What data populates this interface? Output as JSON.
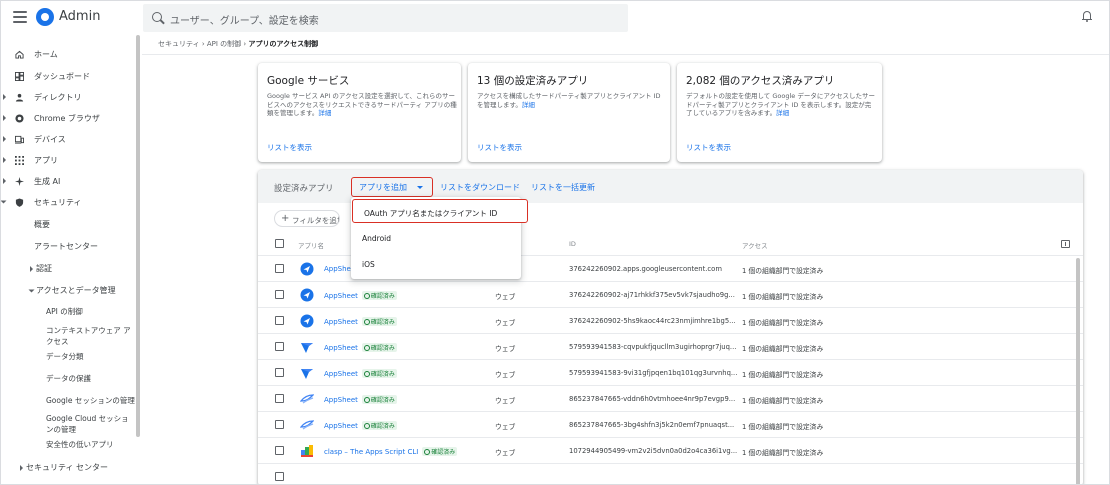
{
  "header": {
    "app_name": "Admin",
    "search_placeholder": "ユーザー、グループ、設定を検索"
  },
  "sidebar": {
    "items": [
      {
        "label": "ホーム",
        "icon": "home-icon"
      },
      {
        "label": "ダッシュボード",
        "icon": "dashboard-icon"
      },
      {
        "label": "ディレクトリ",
        "icon": "person-icon"
      },
      {
        "label": "Chrome ブラウザ",
        "icon": "chrome-icon"
      },
      {
        "label": "デバイス",
        "icon": "devices-icon"
      },
      {
        "label": "アプリ",
        "icon": "apps-grid-icon"
      },
      {
        "label": "生成 AI",
        "icon": "sparkle-icon"
      },
      {
        "label": "セキュリティ",
        "icon": "shield-icon"
      }
    ],
    "security_sub": [
      "概要",
      "アラートセンター",
      "認証",
      "アクセスとデータ管理"
    ],
    "access_sub": [
      "API の制御",
      "コンテキストアウェア アクセス",
      "データ分類",
      "データの保護",
      "Google セッションの管理",
      "Google Cloud セッションの管理",
      "安全性の低いアプリ"
    ],
    "security_center": "セキュリティ センター"
  },
  "breadcrumb": {
    "part1": "セキュリティ",
    "part2": "API の制御",
    "current": "アプリのアクセス制御",
    "sep": "›"
  },
  "cards": [
    {
      "title": "Google サービス",
      "desc": "Google サービス API のアクセス設定を選択して、これらのサービスへのアクセスをリクエストできるサードパーティ アプリの種類を管理します。",
      "more": "詳細",
      "link": "リストを表示"
    },
    {
      "title": "13 個の設定済みアプリ",
      "desc": "アクセスを構成したサードパーティ製アプリとクライアント ID を管理します。",
      "more": "詳細",
      "link": "リストを表示"
    },
    {
      "title": "2,082 個のアクセス済みアプリ",
      "desc": "デフォルトの設定を使用して Google データにアクセスしたサードパーティ製アプリとクライアント ID を表示します。設定が完了しているアプリを含みます。",
      "more": "詳細",
      "link": "リストを表示"
    }
  ],
  "panel": {
    "title": "設定済みアプリ",
    "add_app": "アプリを追加",
    "download": "リストをダウンロード",
    "bulk_update": "リストを一括更新",
    "filter": "フィルタを追加"
  },
  "dropdown": {
    "items": [
      "OAuth アプリ名またはクライアント ID",
      "Android",
      "iOS"
    ]
  },
  "table": {
    "headers": {
      "name": "アプリ名",
      "id": "ID",
      "access": "アクセス"
    },
    "verified_label": "確認済み",
    "rows": [
      {
        "name": "AppSheet",
        "type": "",
        "id": "376242260902.apps.googleusercontent.com",
        "access": "1 個の組織部門で設定済み",
        "icon": "appsheet-blue-icon",
        "verified": false
      },
      {
        "name": "AppSheet",
        "type": "ウェブ",
        "id": "376242260902-aj71rhkkf375ev5vk7sjaudho9g...",
        "access": "1 個の組織部門で設定済み",
        "icon": "appsheet-blue-icon",
        "verified": true
      },
      {
        "name": "AppSheet",
        "type": "ウェブ",
        "id": "376242260902-5hs9kaoc44rc23nmjimhre1bg5...",
        "access": "1 個の組織部門で設定済み",
        "icon": "appsheet-blue-icon",
        "verified": true
      },
      {
        "name": "AppSheet",
        "type": "ウェブ",
        "id": "579593941583-cqvpukfjqucllm3ugirhoprgr7juq...",
        "access": "1 個の組織部門で設定済み",
        "icon": "appsheet-check-icon",
        "verified": true
      },
      {
        "name": "AppSheet",
        "type": "ウェブ",
        "id": "579593941583-9vi31gfjpqen1bq101qg3urvnhq...",
        "access": "1 個の組織部門で設定済み",
        "icon": "appsheet-check-icon",
        "verified": true
      },
      {
        "name": "AppSheet",
        "type": "ウェブ",
        "id": "865237847665-vddn6h0vtmhoee4nr9p7evgp9...",
        "access": "1 個の組織部門で設定済み",
        "icon": "appsheet-wing-icon",
        "verified": true
      },
      {
        "name": "AppSheet",
        "type": "ウェブ",
        "id": "865237847665-3bg4shfn3j5k2n0emf7pnuaqst...",
        "access": "1 個の組織部門で設定済み",
        "icon": "appsheet-wing-icon",
        "verified": true
      },
      {
        "name": "clasp – The Apps Script CLI",
        "type": "ウェブ",
        "id": "1072944905499-vm2v2i5dvn0a0d2o4ca36i1vg...",
        "access": "1 個の組織部門で設定済み",
        "icon": "clasp-icon",
        "verified": true
      }
    ]
  },
  "colors": {
    "accent": "#1a73e8",
    "highlight": "#d93025",
    "verified": "#188038"
  }
}
